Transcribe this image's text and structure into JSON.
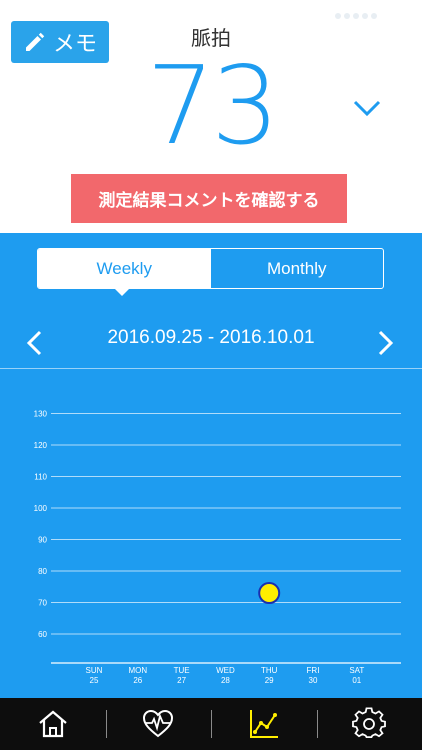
{
  "header": {
    "memo_label": "メモ",
    "metric_label": "脈拍",
    "metric_value": "73",
    "comment_button": "測定結果コメントを確認する"
  },
  "period_tabs": [
    {
      "label": "Weekly",
      "active": true
    },
    {
      "label": "Monthly",
      "active": false
    }
  ],
  "date_range": "2016.09.25 - 2016.10.01",
  "colors": {
    "accent": "#1e9cf0",
    "comment_button": "#f2686c",
    "point_fill": "#ffee00",
    "point_stroke": "#1a2fb0",
    "tabbar_bg": "#0d0d0d",
    "active_tab_icon": "#ffee00"
  },
  "tabbar": [
    {
      "icon": "home-icon",
      "active": false
    },
    {
      "icon": "heart-pulse-icon",
      "active": false
    },
    {
      "icon": "line-chart-icon",
      "active": true
    },
    {
      "icon": "gear-icon",
      "active": false
    }
  ],
  "chart_data": {
    "type": "scatter",
    "categories": [
      "SUN\n25",
      "MON\n26",
      "TUE\n27",
      "WED\n28",
      "THU\n29",
      "FRI\n30",
      "SAT\n01"
    ],
    "x_days": [
      "SUN",
      "MON",
      "TUE",
      "WED",
      "THU",
      "FRI",
      "SAT"
    ],
    "x_dates": [
      "25",
      "26",
      "27",
      "28",
      "29",
      "30",
      "01"
    ],
    "y_ticks": [
      60,
      70,
      80,
      90,
      100,
      110,
      120,
      130
    ],
    "ylim": [
      52,
      134
    ],
    "points": [
      {
        "category": "THU",
        "value": 73
      }
    ],
    "grid": true
  }
}
